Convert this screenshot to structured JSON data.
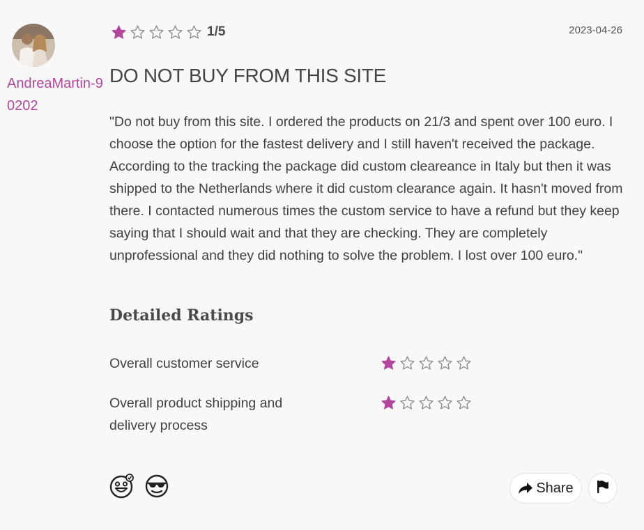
{
  "review": {
    "username": "AndreaMartin-90202",
    "rating_text": "1/5",
    "rating_value": 1,
    "rating_max": 5,
    "date": "2023-04-26",
    "title": "DO NOT BUY FROM THIS SITE",
    "body": "\"Do not buy from this site. I ordered the products on 21/3 and spent over 100 euro. I choose the option for the fastest delivery and I still haven't received the package. According to the tracking the package did custom cleareance in Italy but then it was shipped to the Netherlands where it did custom clearance again. It hasn't moved from there. I contacted numerous times the custom service to have a refund but they keep saying that I should wait and that they are checking. They are completely unprofessional and they did nothing to solve the problem. I lost over 100 euro.\""
  },
  "detailed": {
    "heading": "Detailed Ratings",
    "items": [
      {
        "label": "Overall customer service",
        "rating": 1
      },
      {
        "label": "Overall product shipping and delivery process",
        "rating": 1
      }
    ]
  },
  "actions": {
    "share_label": "Share",
    "icons": [
      "laugh-face-icon",
      "sunglasses-face-icon",
      "share-arrow-icon",
      "flag-icon"
    ]
  },
  "colors": {
    "accent": "#b1479c",
    "star_empty": "#8a8a8a",
    "background": "#f8f8f9"
  }
}
